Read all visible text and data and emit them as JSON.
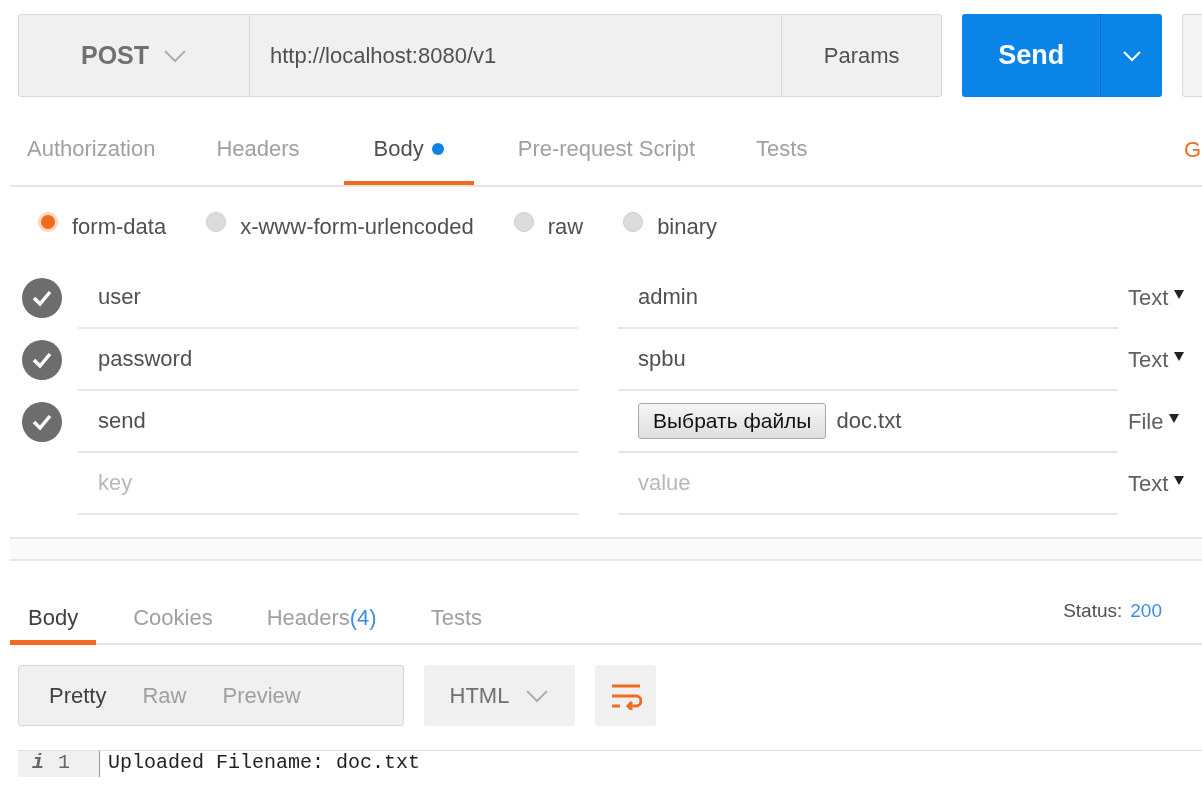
{
  "request": {
    "method": "POST",
    "url": "http://localhost:8080/v1",
    "params_label": "Params",
    "send_label": "Send"
  },
  "request_tabs": [
    {
      "label": "Authorization",
      "selected": false,
      "dot": false
    },
    {
      "label": "Headers",
      "selected": false,
      "dot": false
    },
    {
      "label": "Body",
      "selected": true,
      "dot": true
    },
    {
      "label": "Pre-request Script",
      "selected": false,
      "dot": false
    },
    {
      "label": "Tests",
      "selected": false,
      "dot": false
    }
  ],
  "request_tabs_cut_link": "G",
  "body_types": [
    {
      "label": "form-data",
      "selected": true
    },
    {
      "label": "x-www-form-urlencoded",
      "selected": false
    },
    {
      "label": "raw",
      "selected": false
    },
    {
      "label": "binary",
      "selected": false
    }
  ],
  "form_rows": [
    {
      "checked": true,
      "kind": "text",
      "key": "user",
      "value": "admin",
      "type": "Text"
    },
    {
      "checked": true,
      "kind": "text",
      "key": "password",
      "value": "spbu",
      "type": "Text"
    },
    {
      "checked": true,
      "kind": "file",
      "key": "send",
      "file_button": "Выбрать файлы",
      "value": "doc.txt",
      "type": "File"
    },
    {
      "checked": false,
      "kind": "empty",
      "key_placeholder": "key",
      "value_placeholder": "value",
      "type": "Text"
    }
  ],
  "response_tabs": [
    {
      "label": "Body",
      "selected": true
    },
    {
      "label": "Cookies",
      "selected": false
    },
    {
      "label": "Headers",
      "count": "(4)",
      "selected": false
    },
    {
      "label": "Tests",
      "selected": false
    }
  ],
  "status": {
    "label": "Status:",
    "value": "200"
  },
  "view_modes": [
    {
      "label": "Pretty",
      "selected": true
    },
    {
      "label": "Raw",
      "selected": false
    },
    {
      "label": "Preview",
      "selected": false
    }
  ],
  "language": "HTML",
  "code_lines": [
    {
      "marker": "i",
      "number": "1",
      "text": "Uploaded Filename: doc.txt"
    }
  ]
}
